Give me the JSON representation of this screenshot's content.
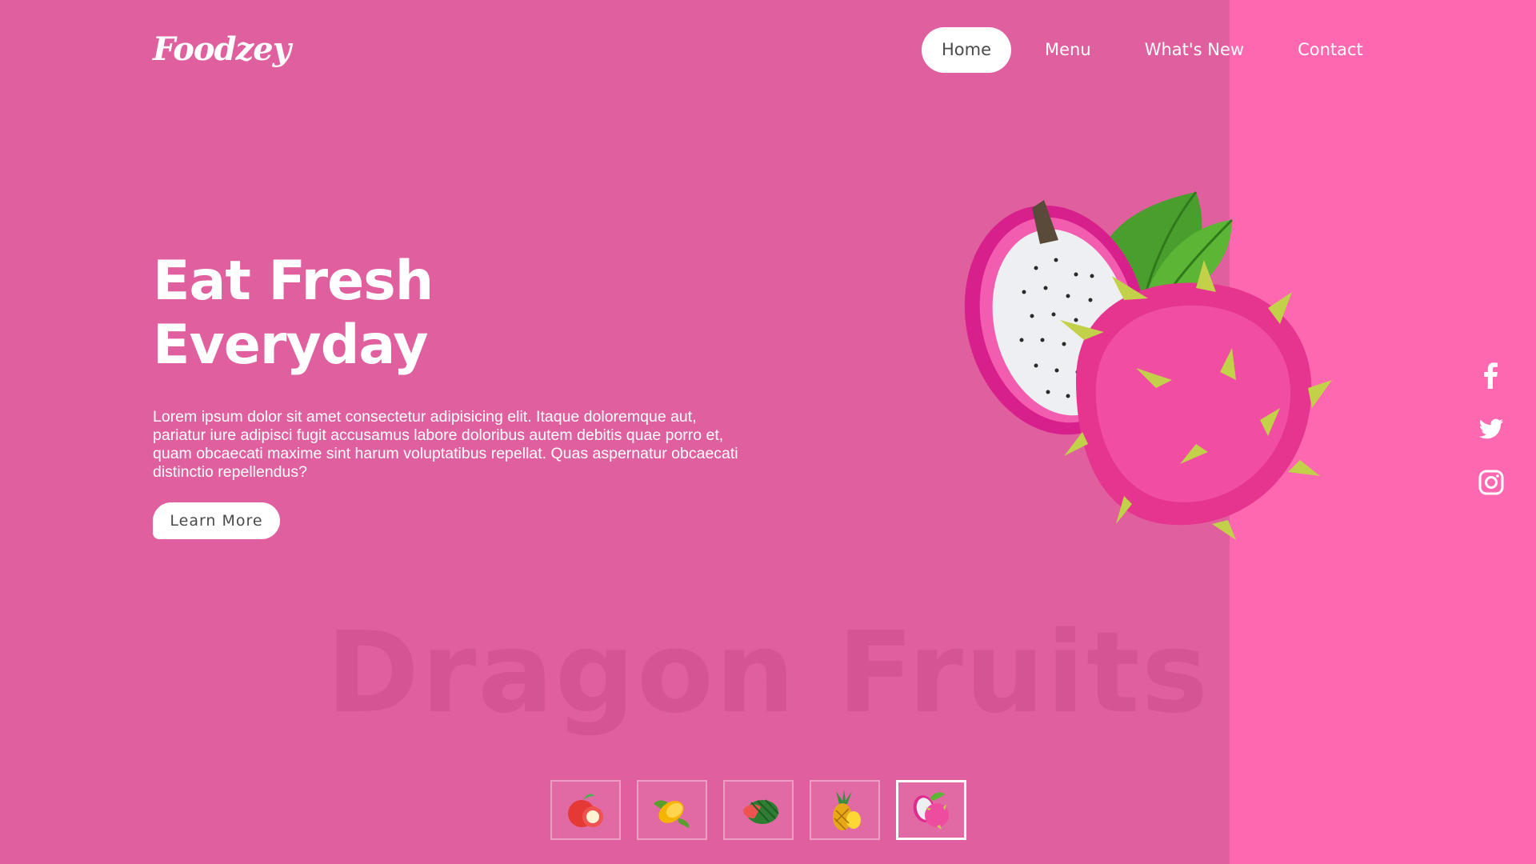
{
  "brand": {
    "logo": "Foodzey"
  },
  "nav": {
    "items": [
      {
        "label": "Home",
        "active": true
      },
      {
        "label": "Menu",
        "active": false
      },
      {
        "label": "What's New",
        "active": false
      },
      {
        "label": "Contact",
        "active": false
      }
    ]
  },
  "hero": {
    "headline_line1": "Eat Fresh",
    "headline_line2": "Everyday",
    "description": "Lorem ipsum dolor sit amet consectetur adipisicing elit. Itaque doloremque aut, pariatur iure adipisci fugit accusamus labore doloribus autem debitis quae porro et, quam obcaecati maxime sint harum voluptatibus repellat. Quas aspernatur obcaecati distinctio repellendus?",
    "cta_label": "Learn More",
    "watermark": "Dragon Fruits",
    "image_icon": "dragon-fruit-image"
  },
  "social": {
    "icons": [
      "facebook-icon",
      "twitter-icon",
      "instagram-icon"
    ]
  },
  "thumbnails": {
    "items": [
      {
        "icon": "apple-thumbnail",
        "active": false
      },
      {
        "icon": "mango-thumbnail",
        "active": false
      },
      {
        "icon": "watermelon-thumbnail",
        "active": false
      },
      {
        "icon": "pineapple-thumbnail",
        "active": false
      },
      {
        "icon": "dragon-fruit-thumbnail",
        "active": true
      }
    ]
  },
  "colors": {
    "background": "#e0609f",
    "side_panel": "#fe68b0",
    "watermark": "#d2508f",
    "text": "#ffffff",
    "button_text": "#4a4a4a"
  }
}
